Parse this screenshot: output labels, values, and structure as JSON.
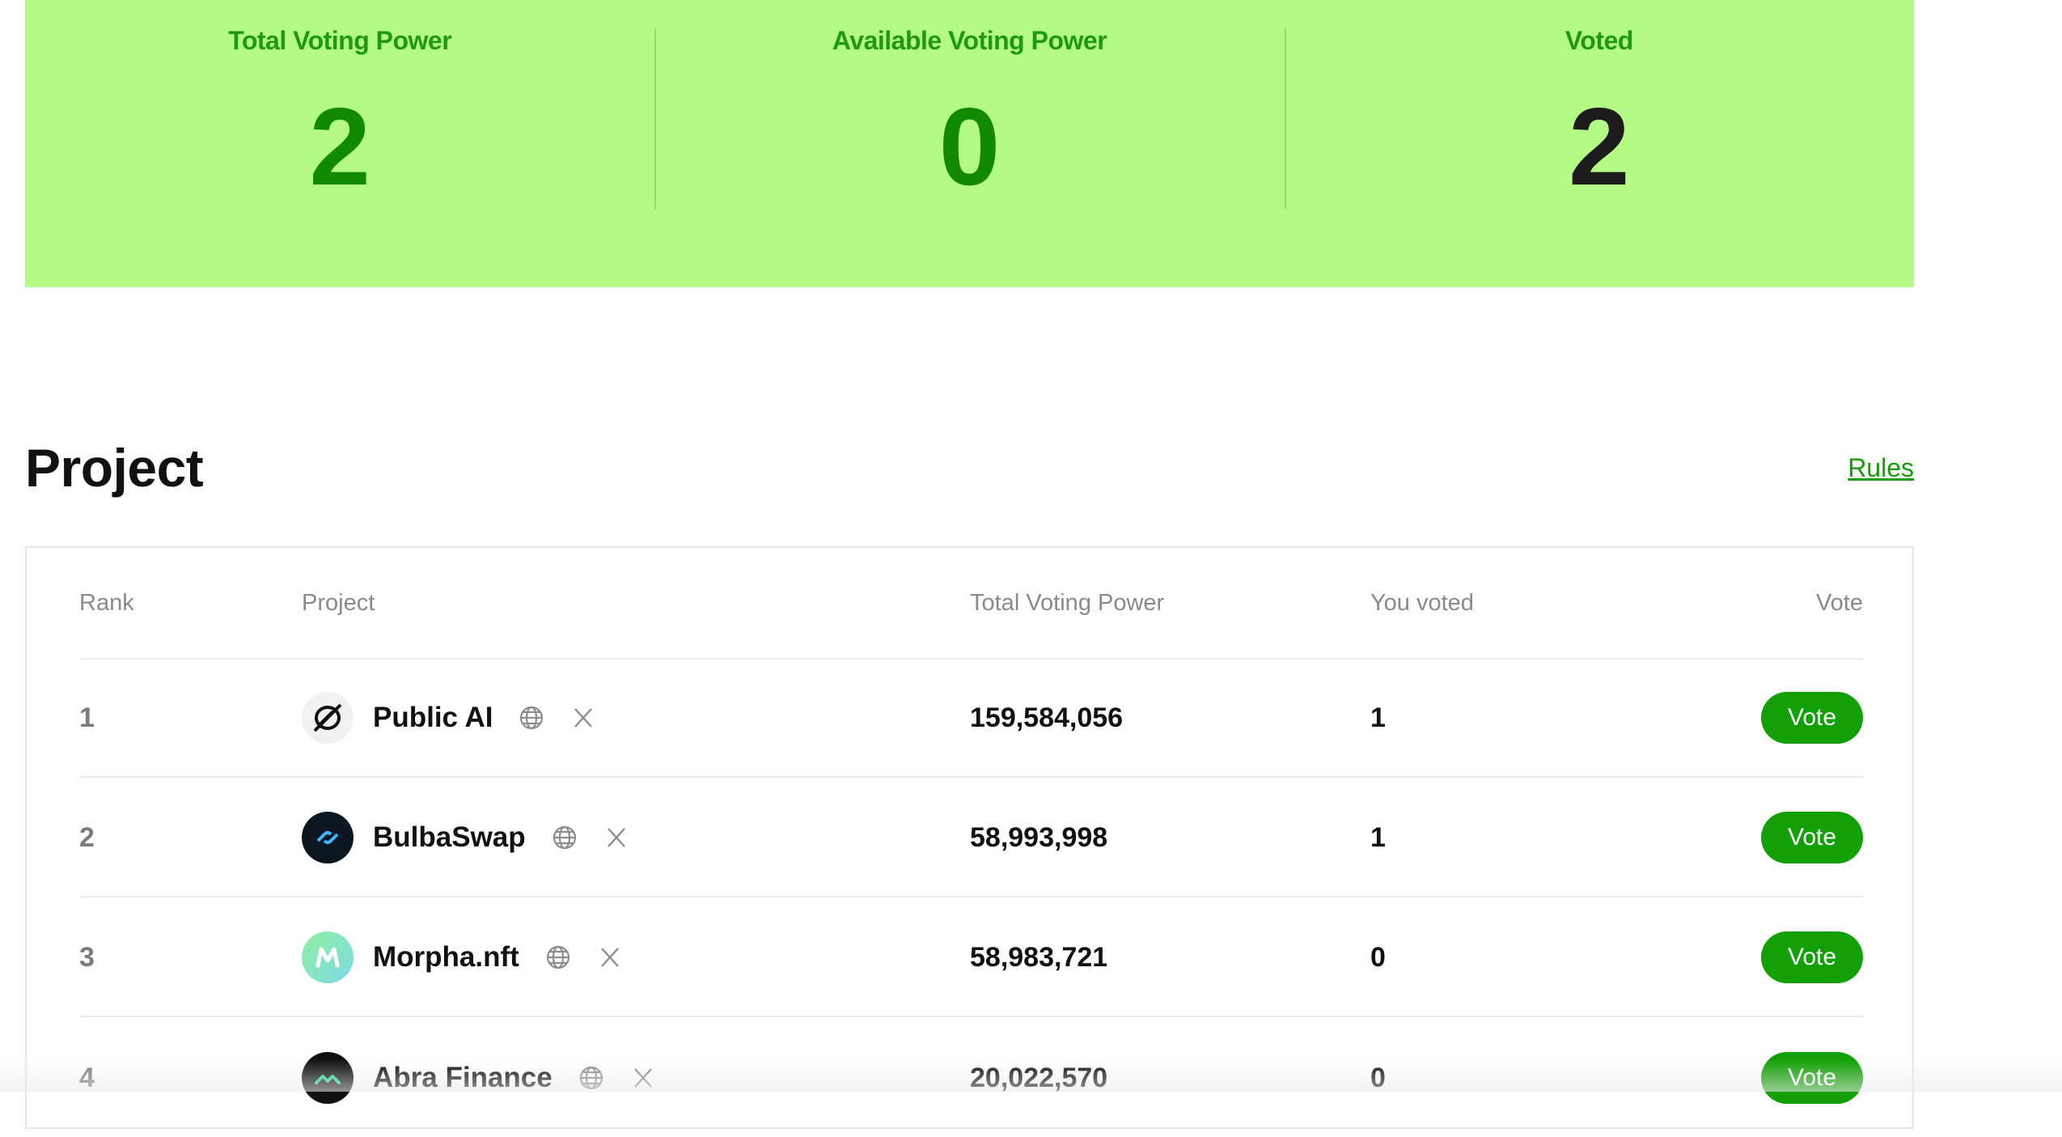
{
  "stats": {
    "total_voting_power_label": "Total Voting Power",
    "total_voting_power_value": "2",
    "available_voting_power_label": "Available Voting Power",
    "available_voting_power_value": "0",
    "voted_label": "Voted",
    "voted_value": "2"
  },
  "section": {
    "title": "Project",
    "rules_link": "Rules"
  },
  "table": {
    "headers": {
      "rank": "Rank",
      "project": "Project",
      "total_voting_power": "Total Voting Power",
      "you_voted": "You voted",
      "vote": "Vote"
    },
    "rows": [
      {
        "rank": "1",
        "name": "Public AI",
        "total_voting_power": "159,584,056",
        "you_voted": "1",
        "vote_label": "Vote"
      },
      {
        "rank": "2",
        "name": "BulbaSwap",
        "total_voting_power": "58,993,998",
        "you_voted": "1",
        "vote_label": "Vote"
      },
      {
        "rank": "3",
        "name": "Morpha.nft",
        "total_voting_power": "58,983,721",
        "you_voted": "0",
        "vote_label": "Vote"
      },
      {
        "rank": "4",
        "name": "Abra Finance",
        "total_voting_power": "20,022,570",
        "you_voted": "0",
        "vote_label": "Vote"
      }
    ]
  },
  "colors": {
    "banner_bg": "#b3fb84",
    "accent_green": "#12a006",
    "stat_green": "#118a02"
  },
  "icons": {
    "website": "globe-icon",
    "social": "x-icon"
  }
}
